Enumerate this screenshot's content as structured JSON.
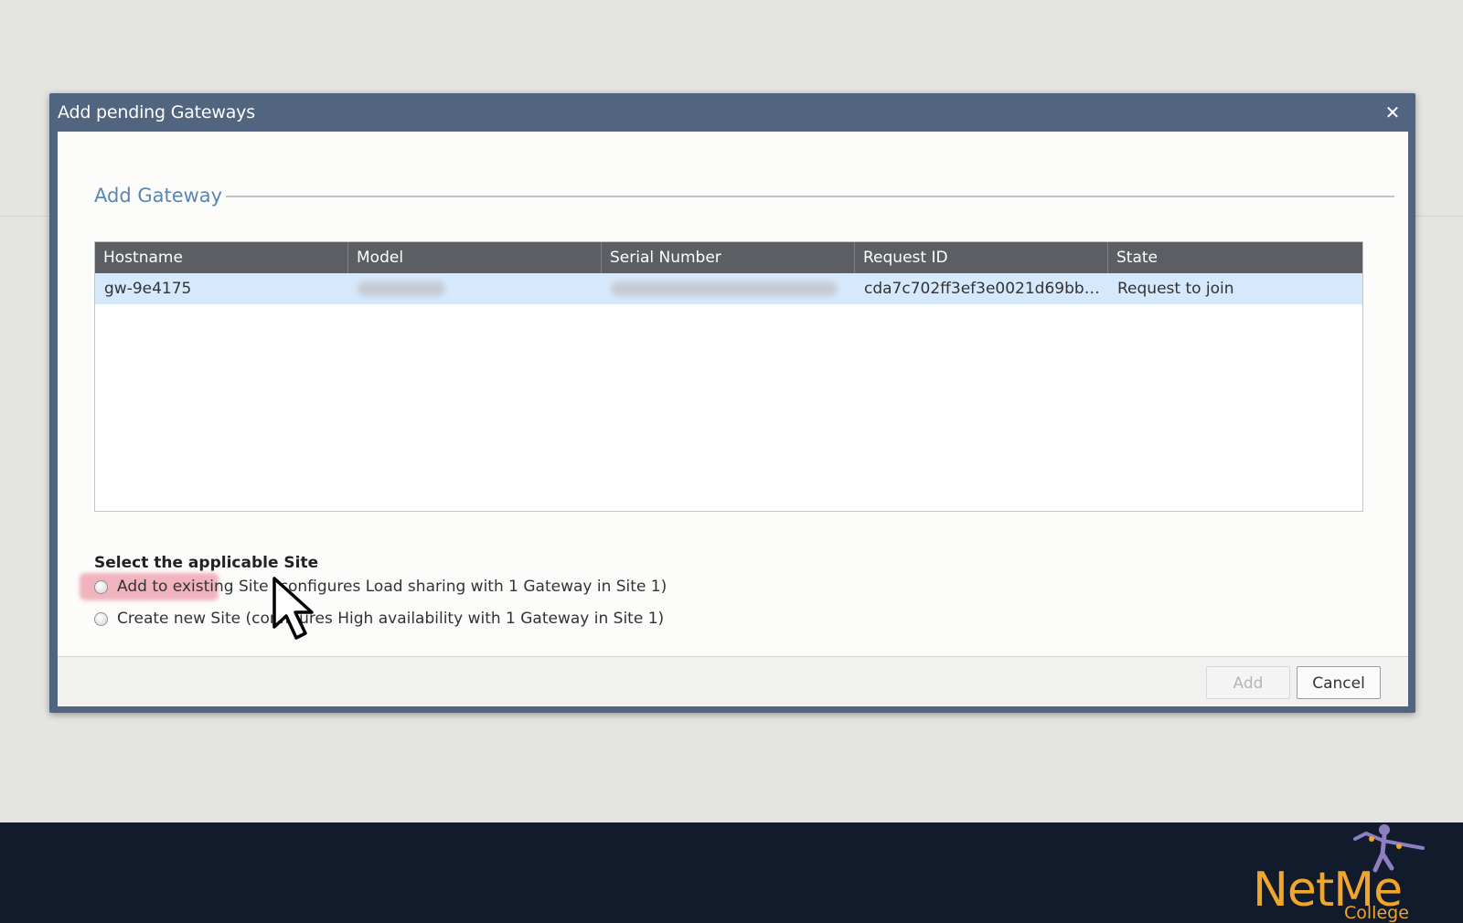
{
  "dialog": {
    "title": "Add pending Gateways",
    "close_icon": "close-icon"
  },
  "section": {
    "title": "Add Gateway"
  },
  "grid": {
    "columns": [
      "Hostname",
      "Model",
      "Serial Number",
      "Request ID",
      "State"
    ],
    "rows": [
      {
        "hostname": "gw-9e4175",
        "model": "",
        "serial": "",
        "request_id": "cda7c702ff3ef3e0021d69bb6c...",
        "state": "Request to join"
      }
    ]
  },
  "site": {
    "label": "Select the applicable Site",
    "options": [
      "Add to existing Site (configures Load sharing with 1 Gateway in Site 1)",
      "Create new Site (configures High availability with 1 Gateway in Site 1)"
    ]
  },
  "footer": {
    "add_label": "Add",
    "cancel_label": "Cancel"
  },
  "brand": {
    "name": "NetMe",
    "sub": "College"
  },
  "colors": {
    "title_bar": "#516580",
    "header_row": "#5b5f64",
    "selected_row": "#d6e8fb",
    "section_title": "#5b86b2",
    "brand": "#f1a52b"
  }
}
